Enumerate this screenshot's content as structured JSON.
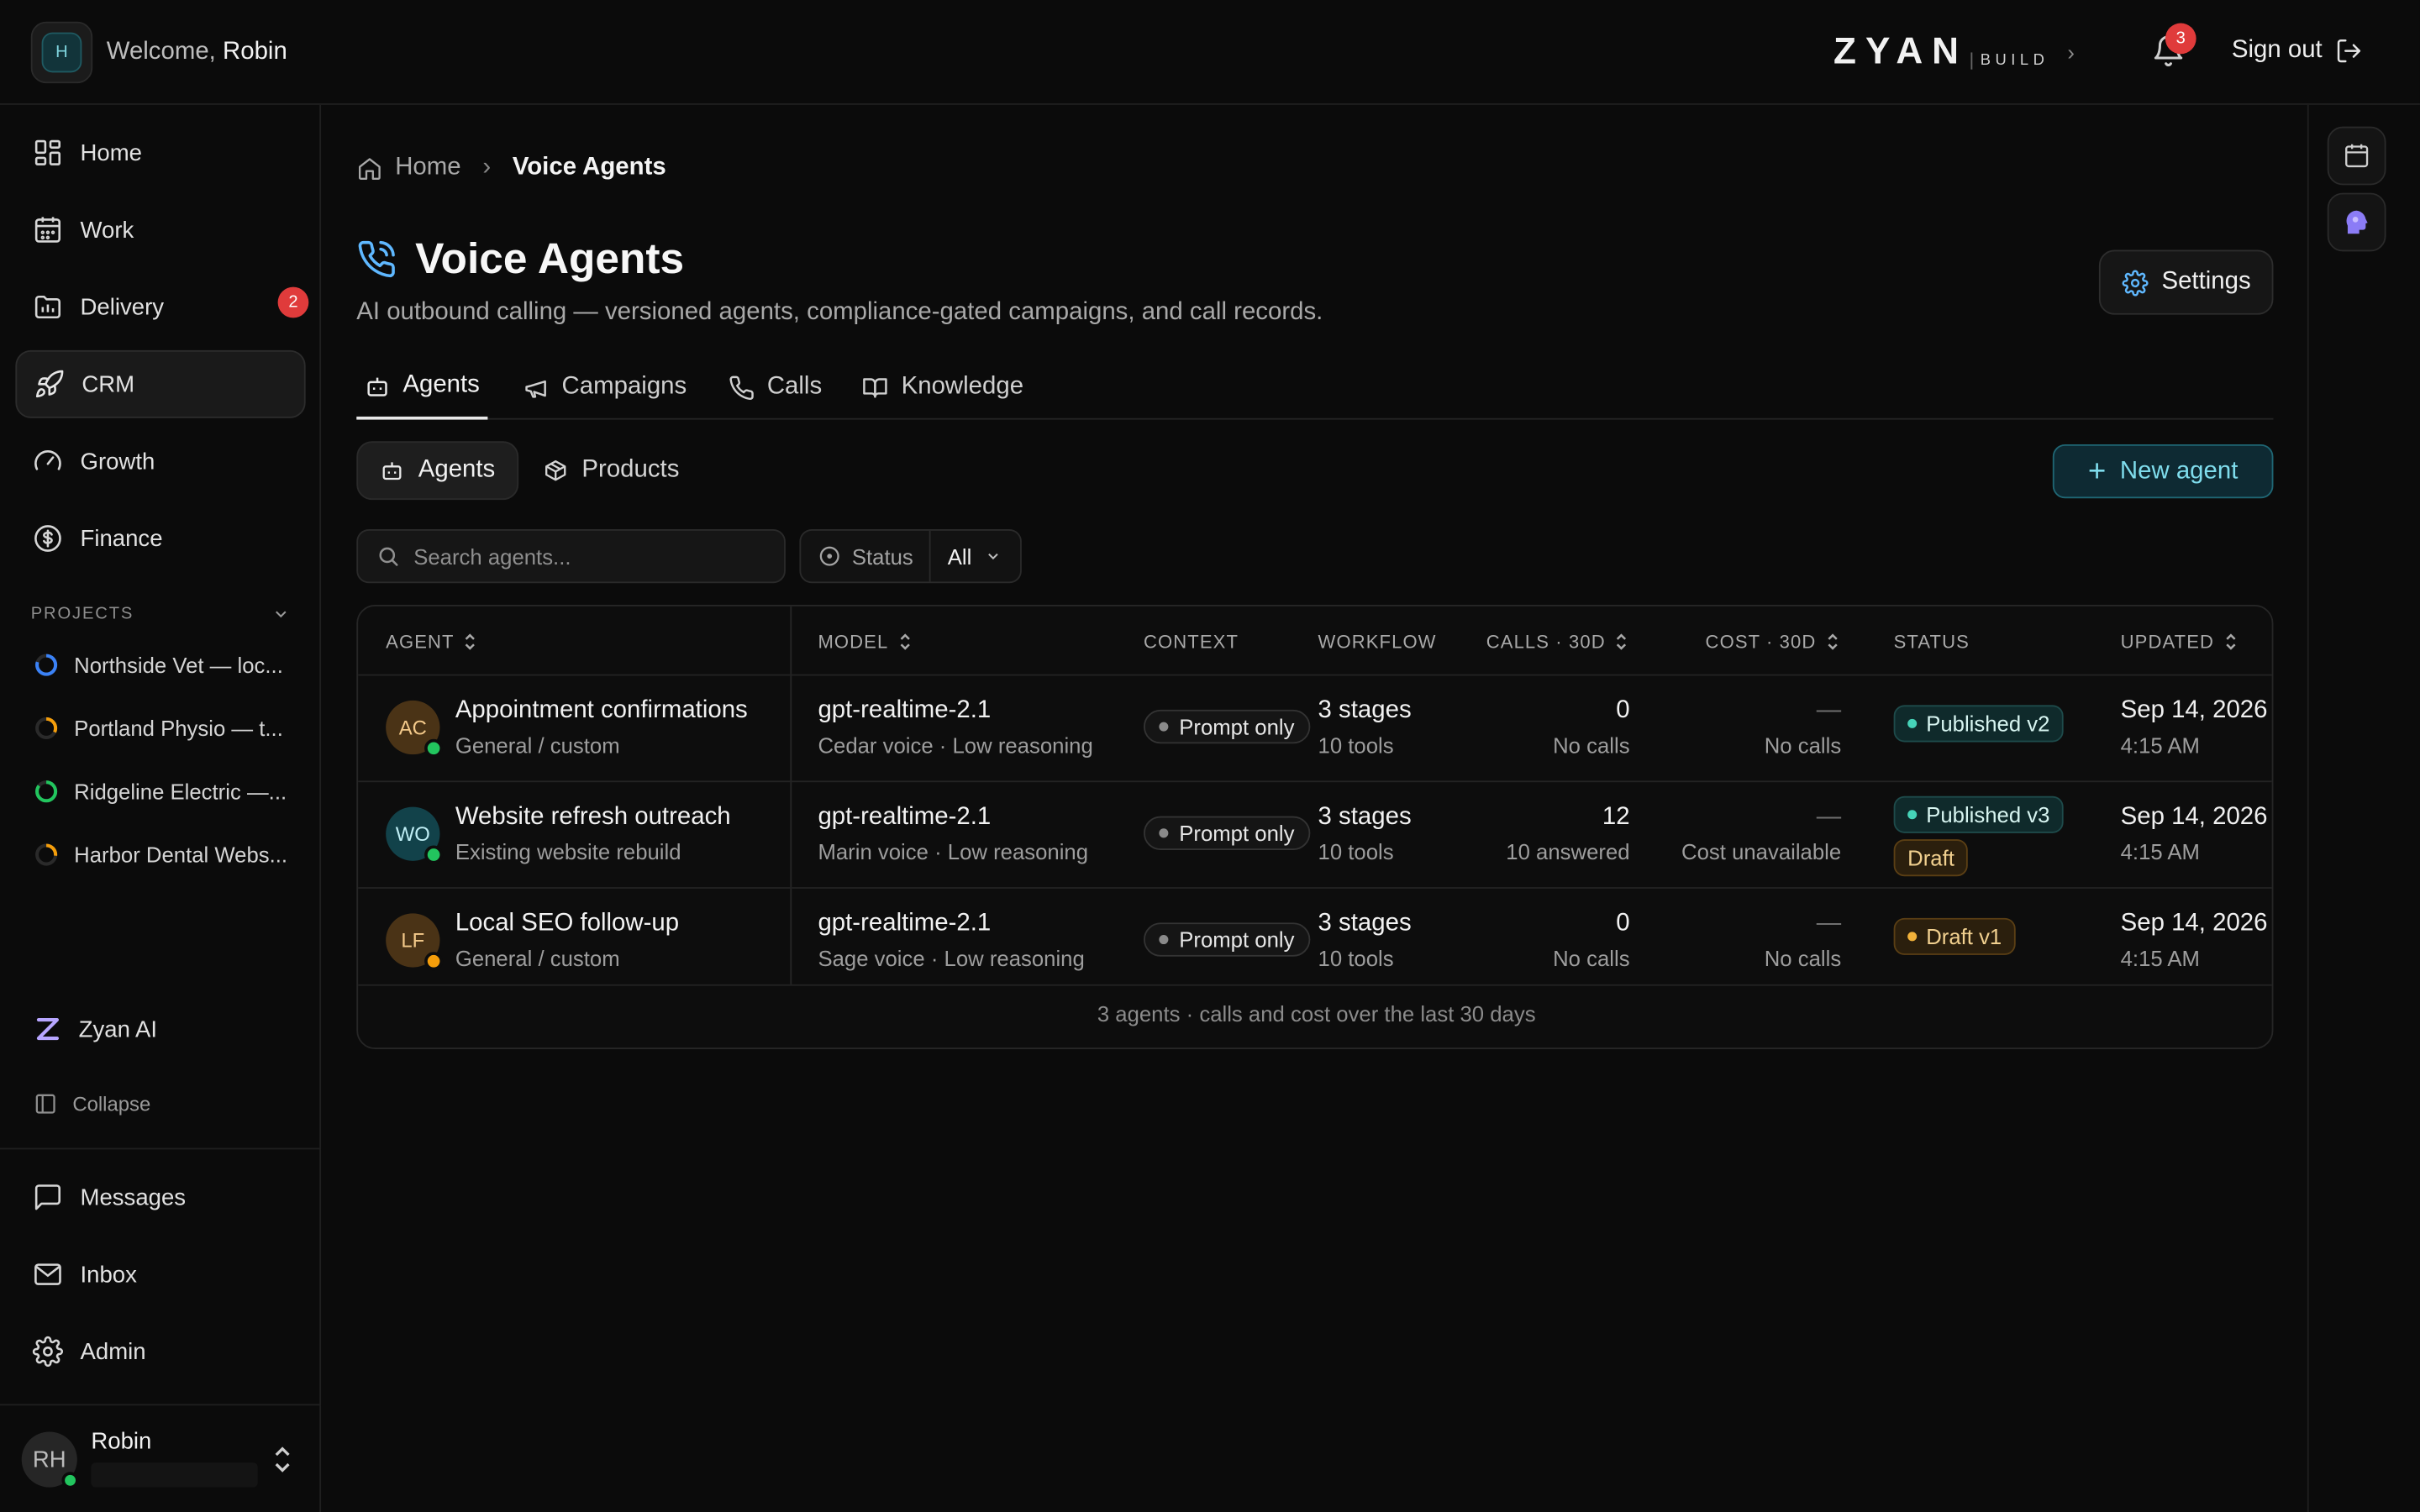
{
  "topbar": {
    "workspace_initial": "H",
    "welcome_prefix": "Welcome, ",
    "welcome_name": "Robin",
    "logo_main": "ZYAN",
    "logo_sub": "BUILD",
    "notif_count": "3",
    "sign_out": "Sign out"
  },
  "sidebar": {
    "nav": [
      {
        "label": "Home"
      },
      {
        "label": "Work"
      },
      {
        "label": "Delivery",
        "badge": "2"
      },
      {
        "label": "CRM"
      },
      {
        "label": "Growth"
      },
      {
        "label": "Finance"
      }
    ],
    "projects_heading": "PROJECTS",
    "projects": [
      {
        "label": "Northside Vet — loc...",
        "color": "#3b82f6"
      },
      {
        "label": "Portland Physio — t...",
        "color": "#f59e0b"
      },
      {
        "label": "Ridgeline Electric —...",
        "color": "#22c55e"
      },
      {
        "label": "Harbor Dental Webs...",
        "color": "#f59e0b"
      }
    ],
    "zyan_ai": "Zyan AI",
    "collapse": "Collapse",
    "bottom_nav": [
      {
        "label": "Messages"
      },
      {
        "label": "Inbox"
      },
      {
        "label": "Admin"
      }
    ],
    "user_initials": "RH",
    "user_name": "Robin"
  },
  "main": {
    "breadcrumb": {
      "home": "Home",
      "current": "Voice Agents"
    },
    "title": "Voice Agents",
    "subtitle": "AI outbound calling — versioned agents, compliance-gated campaigns, and call records.",
    "settings_label": "Settings",
    "tabs": [
      {
        "label": "Agents"
      },
      {
        "label": "Campaigns"
      },
      {
        "label": "Calls"
      },
      {
        "label": "Knowledge"
      }
    ],
    "segments": [
      {
        "label": "Agents"
      },
      {
        "label": "Products"
      }
    ],
    "new_agent_label": "New agent",
    "search_placeholder": "Search agents...",
    "filter": {
      "label": "Status",
      "value": "All"
    }
  },
  "table": {
    "headers": {
      "agent": "AGENT",
      "model": "MODEL",
      "context": "CONTEXT",
      "workflow": "WORKFLOW",
      "calls": "CALLS · 30D",
      "cost": "COST · 30D",
      "status": "STATUS",
      "updated": "UPDATED"
    },
    "rows": [
      {
        "initials": "AC",
        "avatar_bg": "#4a3316",
        "avatar_fg": "#f3c98a",
        "dot": "#22c55e",
        "name": "Appointment confirmations",
        "desc": "General / custom",
        "model": "gpt-realtime-2.1",
        "model_sub": "Cedar voice · Low reasoning",
        "context": "Prompt only",
        "workflow": "3 stages",
        "workflow_sub": "10 tools",
        "calls": "0",
        "calls_sub": "No calls",
        "cost": "—",
        "cost_sub": "No calls",
        "status": [
          {
            "kind": "pub",
            "label": "Published v2",
            "dot": true
          }
        ],
        "updated": "Sep 14, 2026",
        "updated_time": "4:15 AM"
      },
      {
        "initials": "WO",
        "avatar_bg": "#12424a",
        "avatar_fg": "#bfeef5",
        "dot": "#22c55e",
        "name": "Website refresh outreach",
        "desc": "Existing website rebuild",
        "model": "gpt-realtime-2.1",
        "model_sub": "Marin voice · Low reasoning",
        "context": "Prompt only",
        "workflow": "3 stages",
        "workflow_sub": "10 tools",
        "calls": "12",
        "calls_sub": "10 answered",
        "cost": "—",
        "cost_sub": "Cost unavailable",
        "status": [
          {
            "kind": "pub",
            "label": "Published v3",
            "dot": true
          },
          {
            "kind": "draft",
            "label": "Draft",
            "dot": false
          }
        ],
        "updated": "Sep 14, 2026",
        "updated_time": "4:15 AM"
      },
      {
        "initials": "LF",
        "avatar_bg": "#4a3316",
        "avatar_fg": "#f3c98a",
        "dot": "#f59e0b",
        "name": "Local SEO follow-up",
        "desc": "General / custom",
        "model": "gpt-realtime-2.1",
        "model_sub": "Sage voice · Low reasoning",
        "context": "Prompt only",
        "workflow": "3 stages",
        "workflow_sub": "10 tools",
        "calls": "0",
        "calls_sub": "No calls",
        "cost": "—",
        "cost_sub": "No calls",
        "status": [
          {
            "kind": "draft",
            "label": "Draft v1",
            "dot": true
          }
        ],
        "updated": "Sep 14, 2026",
        "updated_time": "4:15 AM"
      }
    ],
    "footer": "3 agents · calls and cost over the last 30 days"
  }
}
